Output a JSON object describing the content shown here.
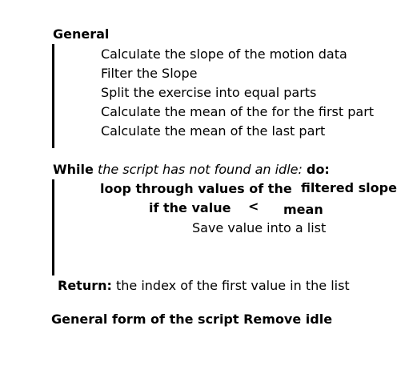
{
  "general": {
    "heading": "General",
    "steps": [
      "Calculate the slope of the motion data",
      "Filter the Slope",
      "Split the exercise into equal parts",
      "Calculate the mean of the for the first part",
      "Calculate the mean of the last part"
    ]
  },
  "loop": {
    "while_keyword": "While",
    "condition": "the script has not found an idle:",
    "do_keyword": "do:",
    "loop_line_a": "loop through values of the",
    "loop_line_b": "filtered slope",
    "if_line": "if the value",
    "operator": "<",
    "mean": "mean",
    "action": "Save value into a list"
  },
  "return": {
    "keyword": "Return:",
    "text": "the index of the first value in the list"
  },
  "caption": "General form of the script Remove idle"
}
